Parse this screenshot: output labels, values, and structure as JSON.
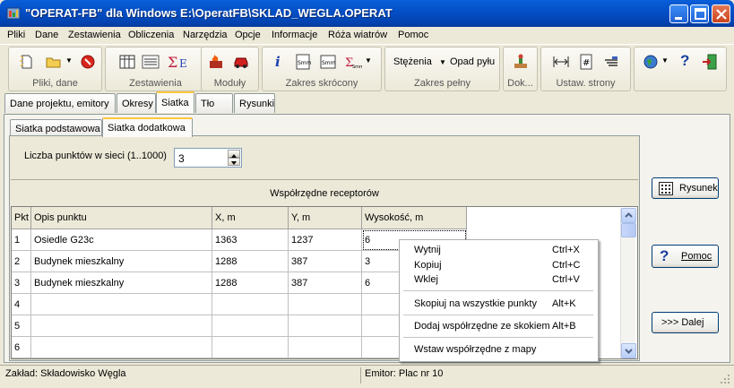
{
  "window": {
    "title": "\"OPERAT-FB\" dla Windows  E:\\OperatFB\\SKLAD_WEGLA.OPERAT"
  },
  "menu": [
    "Pliki",
    "Dane",
    "Zestawienia",
    "Obliczenia",
    "Narzędzia",
    "Opcje",
    "Informacje",
    "Róża wiatrów",
    "Pomoc"
  ],
  "toolbar": {
    "groups": [
      "Pliki, dane",
      "Zestawienia",
      "Moduły",
      "Zakres skrócony",
      "Zakres pełny",
      "Dok...",
      "Ustaw. strony"
    ],
    "stezenia": "Stężenia",
    "opad": "Opad pyłu"
  },
  "tabs": [
    "Dane projektu, emitory",
    "Okresy",
    "Siatka",
    "Tło",
    "Rysunki"
  ],
  "subtabs": [
    "Siatka podstawowa",
    "Siatka dodatkowa"
  ],
  "grid_points": {
    "label": "Liczba punktów w sieci (1..1000)",
    "value": "3"
  },
  "grid": {
    "title": "Współrzędne receptorów",
    "columns": [
      "Pkt",
      "Opis punktu",
      "X, m",
      "Y, m",
      "Wysokość, m"
    ],
    "rows": [
      {
        "pkt": "1",
        "opis": "Osiedle G23c",
        "x": "1363",
        "y": "1237",
        "h": "6"
      },
      {
        "pkt": "2",
        "opis": "Budynek mieszkalny",
        "x": "1288",
        "y": "387",
        "h": "3"
      },
      {
        "pkt": "3",
        "opis": "Budynek mieszkalny",
        "x": "1288",
        "y": "387",
        "h": "6"
      },
      {
        "pkt": "4",
        "opis": "",
        "x": "",
        "y": "",
        "h": ""
      },
      {
        "pkt": "5",
        "opis": "",
        "x": "",
        "y": "",
        "h": ""
      },
      {
        "pkt": "6",
        "opis": "",
        "x": "",
        "y": "",
        "h": ""
      }
    ]
  },
  "buttons": {
    "rysunek": "Rysunek",
    "pomoc": "Pomoc",
    "dalej": ">>> Dalej"
  },
  "context_menu": [
    {
      "label": "Wytnij",
      "shortcut": "Ctrl+X"
    },
    {
      "label": "Kopiuj",
      "shortcut": "Ctrl+C"
    },
    {
      "label": "Wklej",
      "shortcut": "Ctrl+V"
    },
    {
      "label": "Skopiuj na wszystkie punkty",
      "shortcut": "Alt+K"
    },
    {
      "label": "Dodaj współrzędne ze skokiem",
      "shortcut": "Alt+B"
    },
    {
      "label": "Wstaw współrzędne z mapy",
      "shortcut": ""
    }
  ],
  "status": {
    "zaklad": "Zakład: Składowisko Węgla",
    "emitor": "Emitor: Plac nr 10"
  },
  "colors": {
    "titlebar": "#0450c8",
    "tab_active_accent": "#ffc83c",
    "button_border": "#003c74"
  }
}
